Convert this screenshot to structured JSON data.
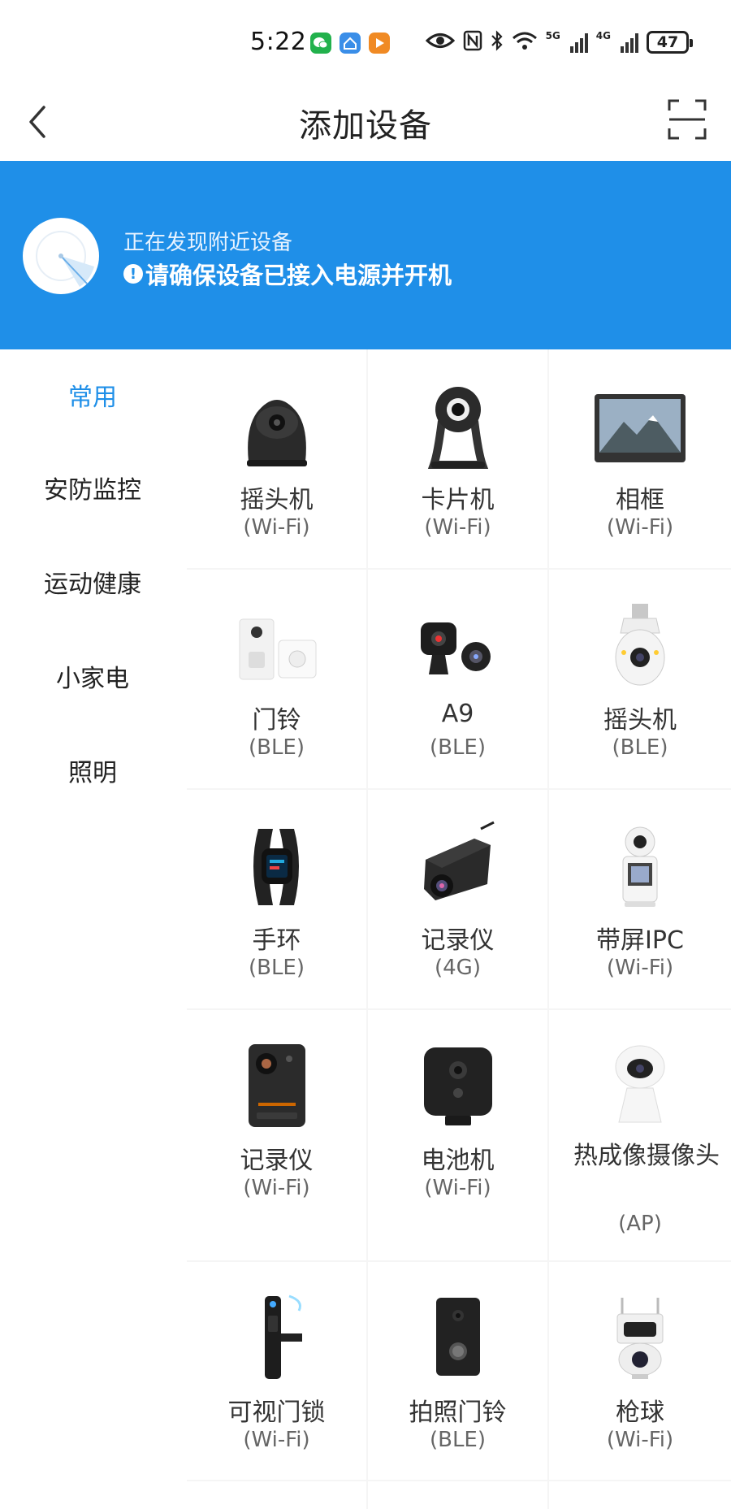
{
  "status_bar": {
    "time": "5:22",
    "net1": "5G",
    "net2": "4G",
    "battery": "47"
  },
  "header": {
    "title": "添加设备"
  },
  "banner": {
    "line1": "正在发现附近设备",
    "line2": "请确保设备已接入电源并开机",
    "warn_glyph": "!"
  },
  "sidebar": {
    "items": [
      {
        "label": "常用",
        "active": true
      },
      {
        "label": "安防监控",
        "active": false
      },
      {
        "label": "运动健康",
        "active": false
      },
      {
        "label": "小家电",
        "active": false
      },
      {
        "label": "照明",
        "active": false
      }
    ]
  },
  "devices": [
    {
      "name": "摇头机",
      "protocol": "(Wi-Fi)",
      "icon": "ptz-camera-icon"
    },
    {
      "name": "卡片机",
      "protocol": "(Wi-Fi)",
      "icon": "card-camera-icon"
    },
    {
      "name": "相框",
      "protocol": "(Wi-Fi)",
      "icon": "photo-frame-icon"
    },
    {
      "name": "门铃",
      "protocol": "(BLE)",
      "icon": "doorbell-icon"
    },
    {
      "name": "A9",
      "protocol": "(BLE)",
      "icon": "mini-camera-icon"
    },
    {
      "name": "摇头机",
      "protocol": "(BLE)",
      "icon": "bulb-camera-icon"
    },
    {
      "name": "手环",
      "protocol": "(BLE)",
      "icon": "fitness-band-icon"
    },
    {
      "name": "记录仪",
      "protocol": "(4G)",
      "icon": "dashcam-icon"
    },
    {
      "name": "带屏IPC",
      "protocol": "(Wi-Fi)",
      "icon": "screen-ipc-icon"
    },
    {
      "name": "记录仪",
      "protocol": "(Wi-Fi)",
      "icon": "body-camera-icon"
    },
    {
      "name": "电池机",
      "protocol": "(Wi-Fi)",
      "icon": "battery-camera-icon"
    },
    {
      "name": "热成像摄像头",
      "protocol": "(AP)",
      "icon": "thermal-camera-icon"
    },
    {
      "name": "可视门锁",
      "protocol": "(Wi-Fi)",
      "icon": "video-door-lock-icon"
    },
    {
      "name": "拍照门铃",
      "protocol": "(BLE)",
      "icon": "photo-doorbell-icon"
    },
    {
      "name": "枪球",
      "protocol": "(Wi-Fi)",
      "icon": "bullet-dome-camera-icon"
    }
  ],
  "colors": {
    "accent": "#1f8fe8",
    "grid_gap": "#f5f5f5"
  }
}
